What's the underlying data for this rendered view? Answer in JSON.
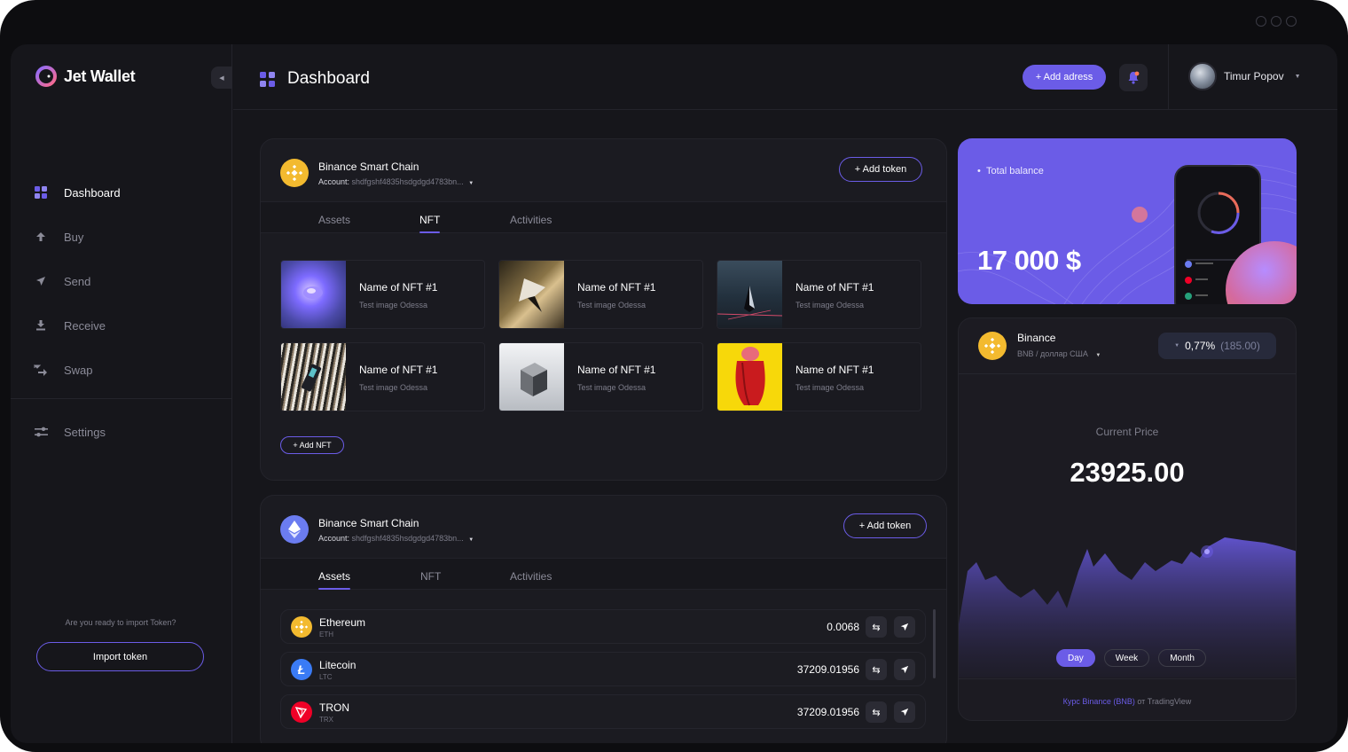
{
  "app": {
    "name": "Jet Wallet"
  },
  "sidebar": {
    "items": [
      {
        "label": "Dashboard",
        "icon": "dashboard-icon",
        "active": true
      },
      {
        "label": "Buy",
        "icon": "arrow-up-icon"
      },
      {
        "label": "Send",
        "icon": "send-icon"
      },
      {
        "label": "Receive",
        "icon": "download-icon"
      },
      {
        "label": "Swap",
        "icon": "swap-icon"
      }
    ],
    "settings_label": "Settings",
    "import_prompt": "Are you ready to import Token?",
    "import_button": "Import token"
  },
  "header": {
    "title": "Dashboard",
    "add_address": "+ Add adress",
    "user_name": "Timur Popov"
  },
  "nft_card": {
    "chain": "Binance Smart Chain",
    "account_label": "Account:",
    "account_address": "shdfgshf4835hsdgdgd4783bn...",
    "add_token": "+ Add token",
    "tabs": [
      "Assets",
      "NFT",
      "Activities"
    ],
    "active_tab": "NFT",
    "nfts": [
      {
        "name": "Name of NFT #1",
        "subtitle": "Test image Odessa"
      },
      {
        "name": "Name of NFT #1",
        "subtitle": "Test image Odessa"
      },
      {
        "name": "Name of NFT #1",
        "subtitle": "Test image Odessa"
      },
      {
        "name": "Name of NFT #1",
        "subtitle": "Test image Odessa"
      },
      {
        "name": "Name of NFT #1",
        "subtitle": "Test image Odessa"
      },
      {
        "name": "Name of NFT #1",
        "subtitle": "Test image Odessa"
      }
    ],
    "add_nft": "+ Add NFT"
  },
  "assets_card": {
    "chain": "Binance Smart Chain",
    "account_label": "Account:",
    "account_address": "shdfgshf4835hsdgdgd4783bn...",
    "add_token": "+ Add token",
    "tabs": [
      "Assets",
      "NFT",
      "Activities"
    ],
    "active_tab": "Assets",
    "assets": [
      {
        "name": "Ethereum",
        "ticker": "ETH",
        "amount": "0.0068",
        "icon": "ethereum-icon",
        "color": "#f3ba2f"
      },
      {
        "name": "Litecoin",
        "ticker": "LTC",
        "amount": "37209.01956",
        "icon": "litecoin-icon",
        "color": "#3a7bf5"
      },
      {
        "name": "TRON",
        "ticker": "TRX",
        "amount": "37209.01956",
        "icon": "tron-icon",
        "color": "#ef0027"
      }
    ]
  },
  "balance": {
    "label": "Total balance",
    "value": "17 000 $"
  },
  "price": {
    "name": "Binance",
    "subtitle": "BNB / доллар США",
    "change_percent": "0,77%",
    "change_value": "(185.00)",
    "current_label": "Current Price",
    "current_value": "23925.00",
    "ranges": [
      "Day",
      "Week",
      "Month"
    ],
    "active_range": "Day",
    "footer_link": "Курс Binance (BNB)",
    "footer_rest": " от TradingView"
  },
  "colors": {
    "accent": "#6b5ce7",
    "binance": "#f3ba2f",
    "background": "#16161b"
  }
}
